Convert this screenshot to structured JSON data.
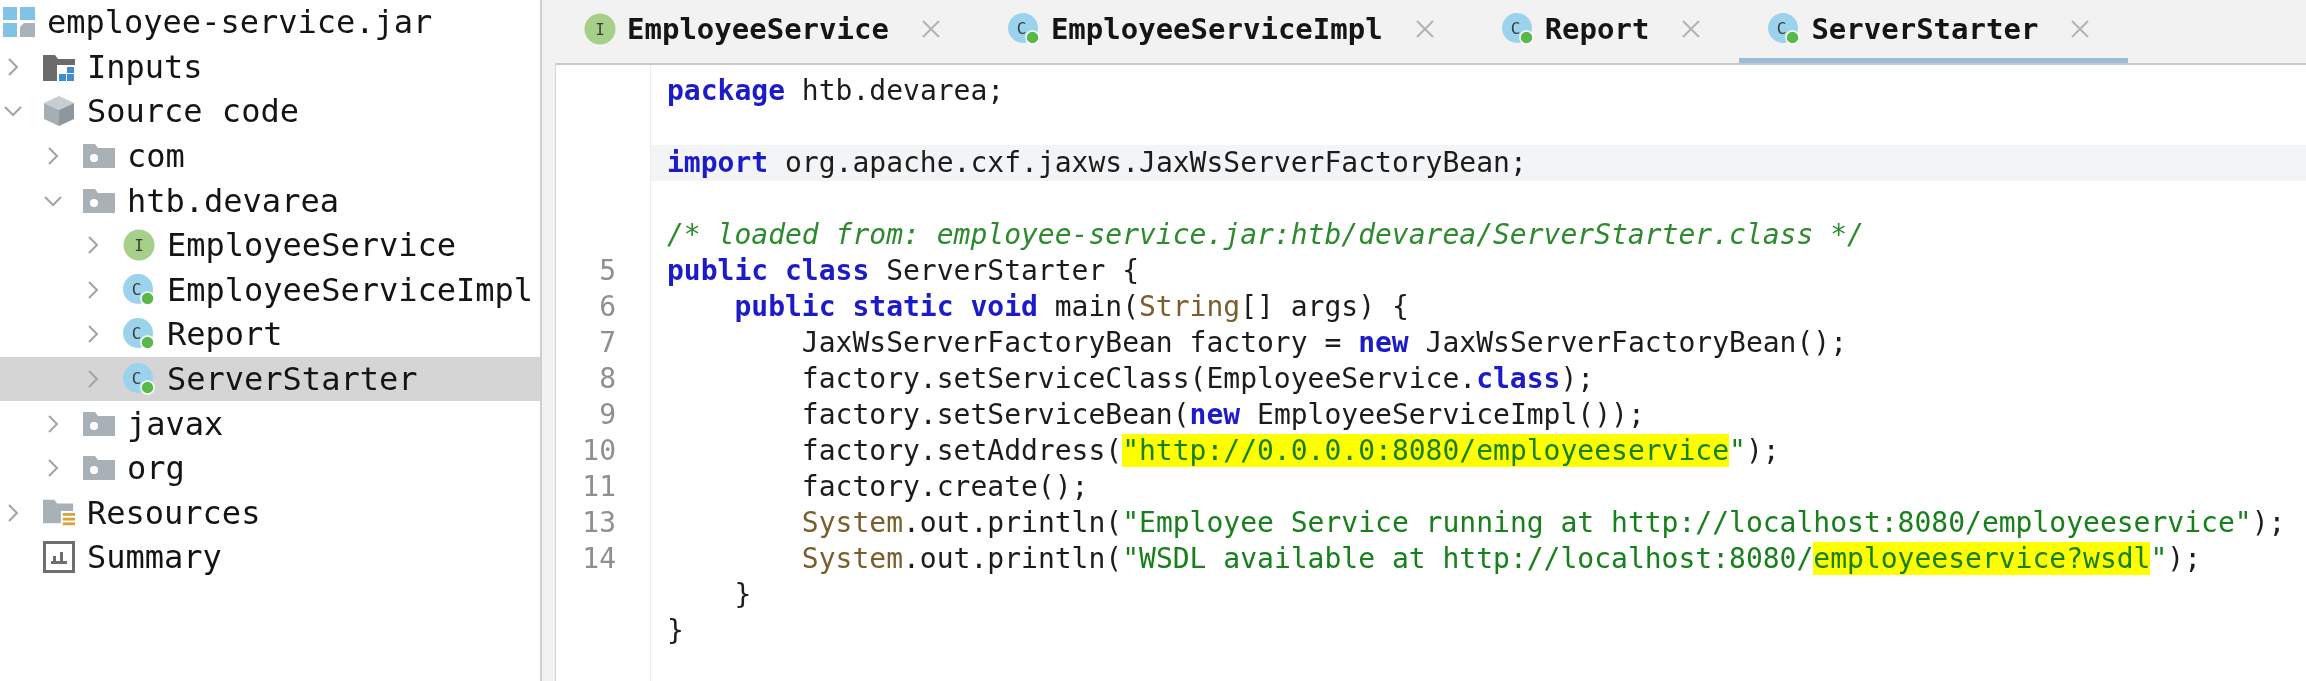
{
  "sidebar": {
    "tree": {
      "label": "employee-service.jar",
      "kind": "archive",
      "selected": false,
      "children": [
        {
          "label": "Inputs",
          "kind": "inputs",
          "expanded": false,
          "selected": false
        },
        {
          "label": "Source code",
          "kind": "source",
          "expanded": true,
          "selected": false,
          "children": [
            {
              "label": "com",
              "kind": "package",
              "expanded": false,
              "selected": false
            },
            {
              "label": "htb.devarea",
              "kind": "package",
              "expanded": true,
              "selected": false,
              "children": [
                {
                  "label": "EmployeeService",
                  "kind": "interface",
                  "badge": "I",
                  "expanded": false,
                  "selected": false
                },
                {
                  "label": "EmployeeServiceImpl",
                  "kind": "class",
                  "badge": "C",
                  "expanded": false,
                  "selected": false
                },
                {
                  "label": "Report",
                  "kind": "class",
                  "badge": "C",
                  "expanded": false,
                  "selected": false
                },
                {
                  "label": "ServerStarter",
                  "kind": "class",
                  "badge": "C",
                  "expanded": false,
                  "selected": true
                }
              ]
            },
            {
              "label": "javax",
              "kind": "package",
              "expanded": false,
              "selected": false
            },
            {
              "label": "org",
              "kind": "package",
              "expanded": false,
              "selected": false
            }
          ]
        },
        {
          "label": "Resources",
          "kind": "resources",
          "expanded": false,
          "selected": false
        },
        {
          "label": "Summary",
          "kind": "summary",
          "selected": false
        }
      ]
    }
  },
  "tabs": [
    {
      "label": "EmployeeService",
      "kind": "interface",
      "badge": "I",
      "selected": false
    },
    {
      "label": "EmployeeServiceImpl",
      "kind": "class",
      "badge": "C",
      "selected": false
    },
    {
      "label": "Report",
      "kind": "class",
      "badge": "C",
      "selected": false
    },
    {
      "label": "ServerStarter",
      "kind": "class",
      "badge": "C",
      "selected": true
    }
  ],
  "editor": {
    "lines": [
      {
        "current": false,
        "tokens": [
          {
            "text": "package",
            "kind": "keyword"
          },
          {
            "text": " htb.devarea;",
            "kind": "plain"
          }
        ]
      },
      {
        "current": false
      },
      {
        "current": true,
        "tokens": [
          {
            "text": "import",
            "kind": "keyword"
          },
          {
            "text": " org.apache.cxf.jaxws.JaxWsServerFactoryBean;",
            "kind": "plain"
          }
        ]
      },
      {
        "current": false
      },
      {
        "current": false,
        "tokens": [
          {
            "text": "/* loaded from: employee-service.jar:htb/devarea/ServerStarter.class */",
            "kind": "comment"
          }
        ]
      },
      {
        "number": "5",
        "current": false,
        "tokens": [
          {
            "text": "public class",
            "kind": "keyword"
          },
          {
            "text": " ServerStarter {",
            "kind": "plain"
          }
        ]
      },
      {
        "number": "6",
        "current": false,
        "tokens": [
          {
            "text": "    public static void",
            "kind": "keyword"
          },
          {
            "text": " main(",
            "kind": "plain"
          },
          {
            "text": "String",
            "kind": "type"
          },
          {
            "text": "[] args) {",
            "kind": "plain"
          }
        ]
      },
      {
        "number": "7",
        "current": false,
        "tokens": [
          {
            "text": "        JaxWsServerFactoryBean factory = ",
            "kind": "plain"
          },
          {
            "text": "new",
            "kind": "keyword"
          },
          {
            "text": " JaxWsServerFactoryBean();",
            "kind": "plain"
          }
        ]
      },
      {
        "number": "8",
        "current": false,
        "tokens": [
          {
            "text": "        factory.setServiceClass(EmployeeService.",
            "kind": "plain"
          },
          {
            "text": "class",
            "kind": "keyword"
          },
          {
            "text": ");",
            "kind": "plain"
          }
        ]
      },
      {
        "number": "9",
        "current": false,
        "tokens": [
          {
            "text": "        factory.setServiceBean(",
            "kind": "plain"
          },
          {
            "text": "new",
            "kind": "keyword"
          },
          {
            "text": " EmployeeServiceImpl());",
            "kind": "plain"
          }
        ]
      },
      {
        "number": "10",
        "current": false,
        "tokens": [
          {
            "text": "        factory.setAddress(",
            "kind": "plain"
          },
          {
            "text": "\"http://0.0.0.0:8080/employeeservice",
            "kind": "marked"
          },
          {
            "text": "\"",
            "kind": "string"
          },
          {
            "text": ");",
            "kind": "plain"
          }
        ]
      },
      {
        "number": "11",
        "current": false,
        "tokens": [
          {
            "text": "        factory.create();",
            "kind": "plain"
          }
        ]
      },
      {
        "number": "13",
        "current": false,
        "tokens": [
          {
            "text": "        System",
            "kind": "type"
          },
          {
            "text": ".out.println(",
            "kind": "plain"
          },
          {
            "text": "\"Employee Service running at http://localhost:8080/employeeservice\"",
            "kind": "string"
          },
          {
            "text": ");",
            "kind": "plain"
          }
        ]
      },
      {
        "number": "14",
        "current": false,
        "tokens": [
          {
            "text": "        System",
            "kind": "type"
          },
          {
            "text": ".out.println(",
            "kind": "plain"
          },
          {
            "text": "\"WSDL available at http://localhost:8080/",
            "kind": "string"
          },
          {
            "text": "employeeservice?wsdl",
            "kind": "marked"
          },
          {
            "text": "\"",
            "kind": "string"
          },
          {
            "text": ");",
            "kind": "plain"
          }
        ]
      },
      {
        "current": false,
        "tokens": [
          {
            "text": "    }",
            "kind": "plain"
          }
        ]
      },
      {
        "current": false,
        "tokens": [
          {
            "text": "}",
            "kind": "plain"
          }
        ]
      }
    ]
  }
}
